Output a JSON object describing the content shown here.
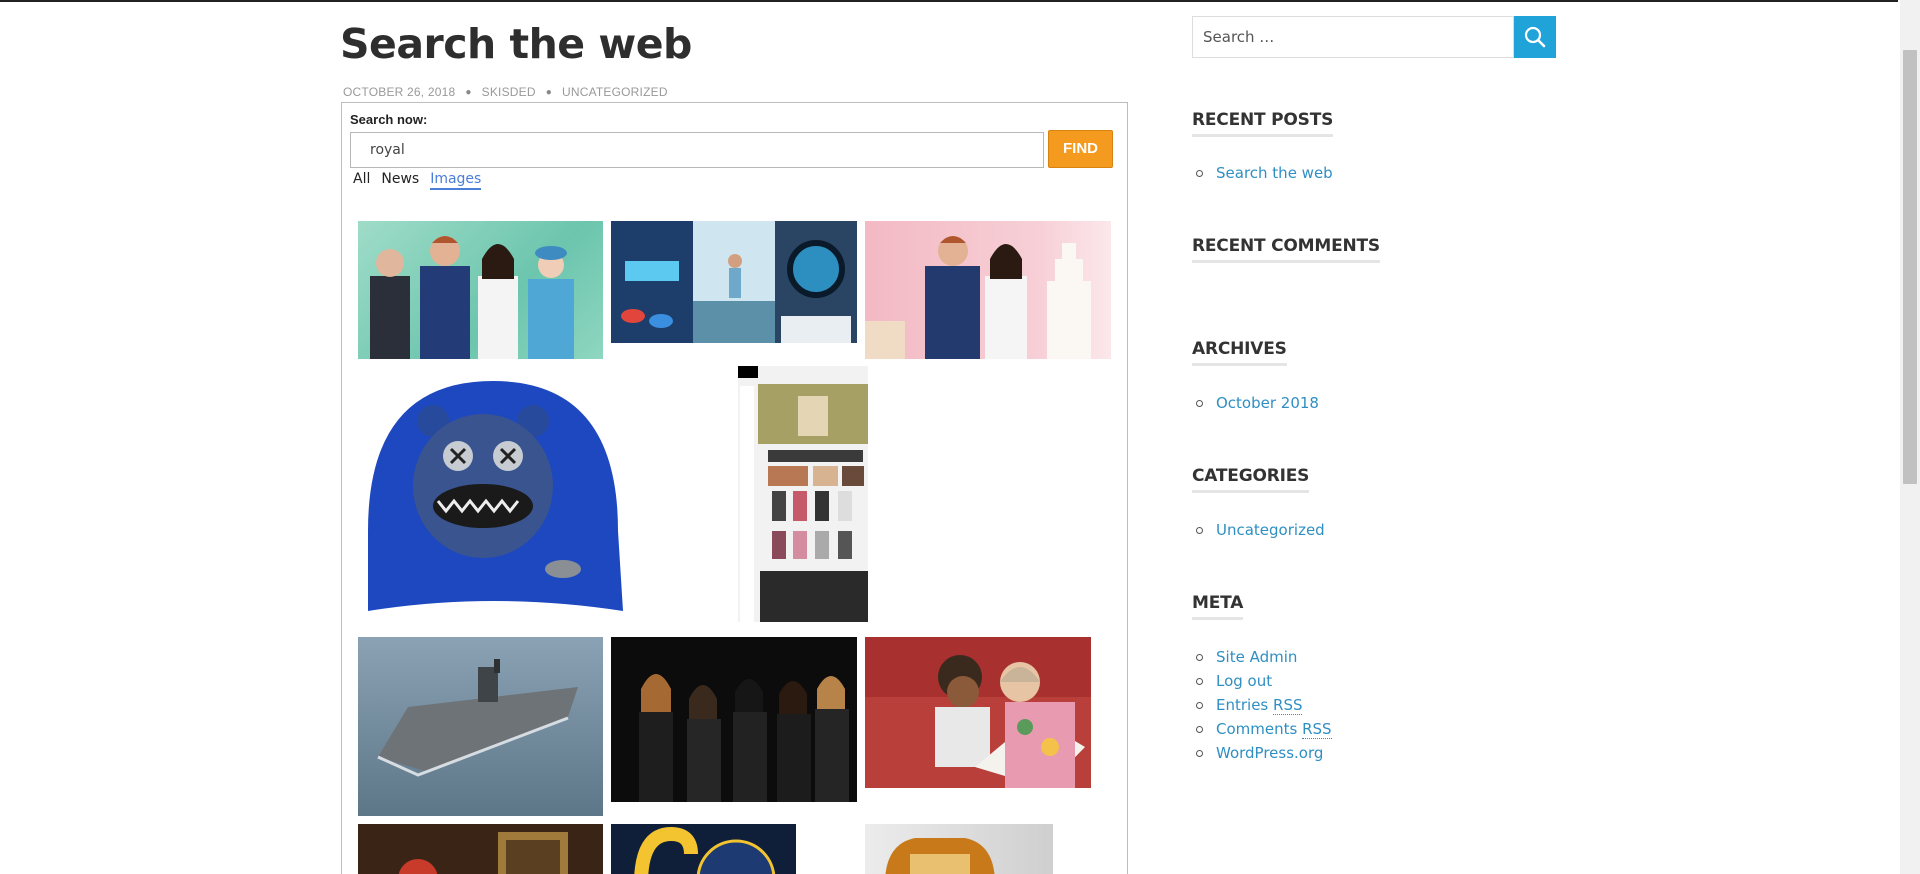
{
  "post": {
    "title": "Search the web",
    "date": "OCTOBER 26, 2018",
    "author": "SKISDED",
    "category": "UNCATEGORIZED"
  },
  "search_widget": {
    "label": "Search now:",
    "query": "royal",
    "find_label": "FIND",
    "tabs": [
      {
        "label": "All",
        "active": false
      },
      {
        "label": "News",
        "active": false
      },
      {
        "label": "Images",
        "active": true
      }
    ]
  },
  "sidebar": {
    "search_placeholder": "Search …",
    "recent_posts_title": "RECENT POSTS",
    "recent_posts": [
      "Search the web"
    ],
    "recent_comments_title": "RECENT COMMENTS",
    "archives_title": "ARCHIVES",
    "archives": [
      "October 2018"
    ],
    "categories_title": "CATEGORIES",
    "categories": [
      "Uncategorized"
    ],
    "meta_title": "META",
    "meta": {
      "site_admin": "Site Admin",
      "log_out": "Log out",
      "entries_prefix": "Entries ",
      "entries_abbr": "RSS",
      "comments_prefix": "Comments ",
      "comments_abbr": "RSS",
      "wordpress": "WordPress.org"
    }
  },
  "colors": {
    "link": "#2f8fc3",
    "find_button": "#f49a1f",
    "search_button": "#1fa3d9",
    "active_tab": "#4a7ed8"
  },
  "icons": {
    "sidebar_search": "search-icon"
  }
}
